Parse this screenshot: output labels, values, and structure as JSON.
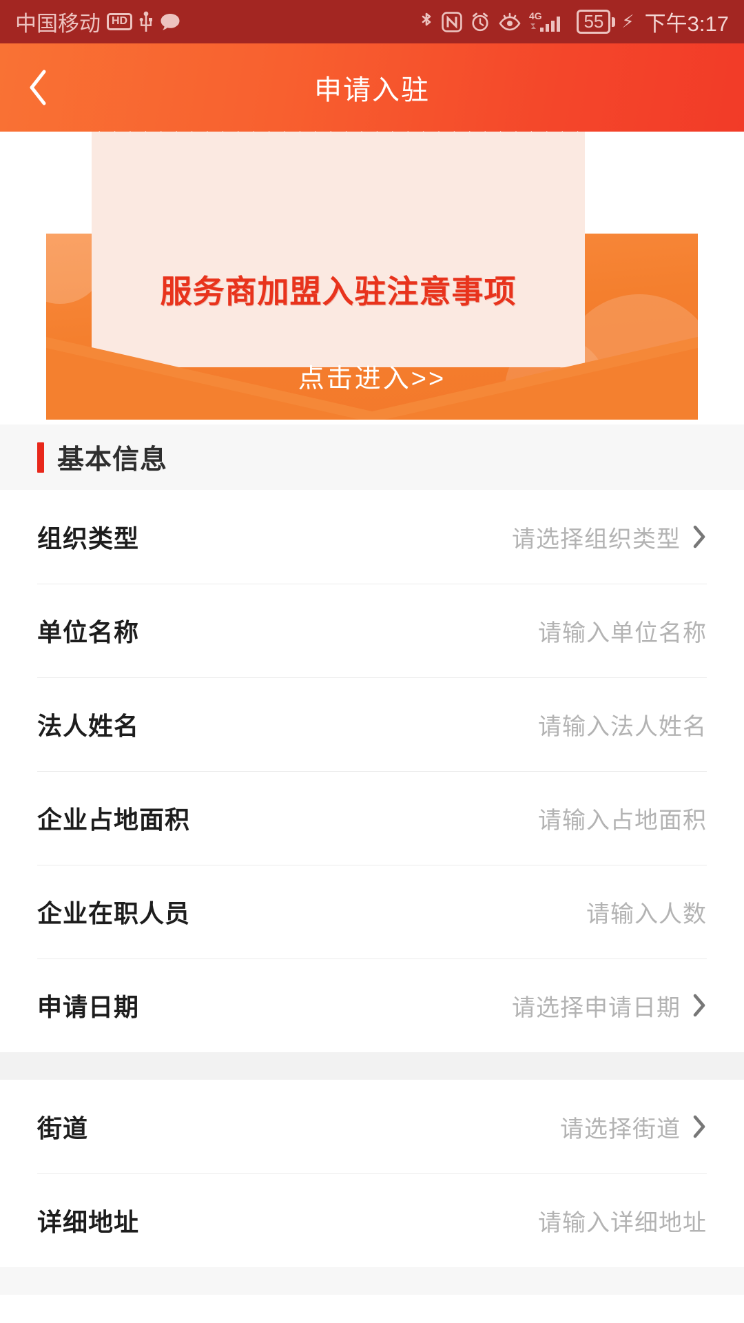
{
  "statusbar": {
    "carrier": "中国移动",
    "hd_label": "HD",
    "battery_level": "55",
    "time": "下午3:17",
    "icons_left": [
      "hd-icon",
      "usb-icon",
      "message-bubble-icon"
    ],
    "icons_right": [
      "bluetooth-icon",
      "nfc-icon",
      "alarm-clock-icon",
      "eye-care-icon",
      "4g-signal-icon",
      "battery-icon",
      "charging-bolt-icon"
    ],
    "background_color": "#a32622",
    "foreground_color": "#edc3c0"
  },
  "header": {
    "title": "申请入驻",
    "back_icon": "chevron-left-icon",
    "gradient_from": "#f97234",
    "gradient_to": "#f23b28"
  },
  "banner": {
    "title": "服务商加盟入驻注意事项",
    "cta": "点击进入>>",
    "title_color": "#e8331c",
    "paper_color": "#fbe9e1",
    "envelope_color": "#f4802f"
  },
  "section": {
    "title": "基本信息",
    "accent_color": "#e8281b"
  },
  "form": {
    "groups": [
      {
        "rows": [
          {
            "label": "组织类型",
            "value": "请选择组织类型",
            "type": "select",
            "icon": "chevron-right-icon"
          },
          {
            "label": "单位名称",
            "value": "请输入单位名称",
            "type": "input",
            "icon": ""
          },
          {
            "label": "法人姓名",
            "value": "请输入法人姓名",
            "type": "input",
            "icon": ""
          },
          {
            "label": "企业占地面积",
            "value": "请输入占地面积",
            "type": "input",
            "icon": ""
          },
          {
            "label": "企业在职人员",
            "value": "请输入人数",
            "type": "input",
            "icon": ""
          },
          {
            "label": "申请日期",
            "value": "请选择申请日期",
            "type": "select",
            "icon": "chevron-right-icon"
          }
        ]
      },
      {
        "rows": [
          {
            "label": "街道",
            "value": "请选择街道",
            "type": "select",
            "icon": "chevron-right-icon"
          },
          {
            "label": "详细地址",
            "value": "请输入详细地址",
            "type": "input",
            "icon": ""
          }
        ]
      }
    ]
  }
}
